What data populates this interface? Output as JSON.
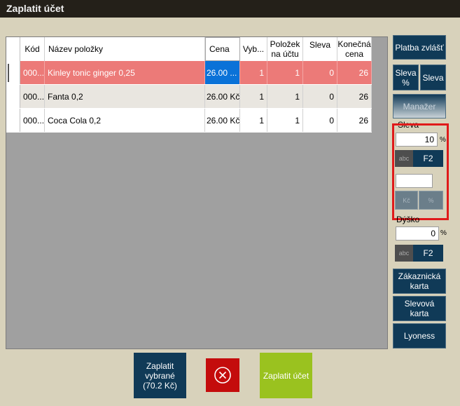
{
  "window": {
    "title": "Zaplatit účet"
  },
  "table": {
    "headers": {
      "kod": "Kód",
      "nazev": "Název položky",
      "cena": "Cena",
      "vyb": "Vyb...",
      "polozek_1": "Položek",
      "polozek_2": "na účtu",
      "sleva": "Sleva",
      "konecna_1": "Konečná",
      "konecna_2": "cena"
    },
    "rows": [
      {
        "kod": "000...",
        "nazev": "Kinley tonic ginger 0,25",
        "cena": "26.00 ...",
        "vyb": "1",
        "polozek": "1",
        "sleva": "0",
        "konecna": "26"
      },
      {
        "kod": "000...",
        "nazev": "Fanta 0,2",
        "cena": "26.00 Kč",
        "vyb": "1",
        "polozek": "1",
        "sleva": "0",
        "konecna": "26"
      },
      {
        "kod": "000...",
        "nazev": "Coca Cola 0,2",
        "cena": "26.00 Kč",
        "vyb": "1",
        "polozek": "1",
        "sleva": "0",
        "konecna": "26"
      }
    ]
  },
  "side": {
    "platba_zvlast": "Platba zvlášť",
    "sleva_pct_1": "Sleva",
    "sleva_pct_2": "%",
    "sleva_btn": "Sleva",
    "manager": "Manažer",
    "sleva_label": "Sleva",
    "sleva_value": "10",
    "percent": "%",
    "abc": "abc",
    "f2": "F2",
    "kc": "Kč",
    "pct_small": "%",
    "dysko_label": "Dýško",
    "dysko_value": "0",
    "zakaznicka_1": "Zákaznická",
    "zakaznicka_2": "karta",
    "slevova_1": "Slevová",
    "slevova_2": "karta",
    "lyoness": "Lyoness"
  },
  "bottom": {
    "zaplatit_vybrane_1": "Zaplatit",
    "zaplatit_vybrane_2": "vybrané",
    "zaplatit_vybrane_3": "(70.2 Kč)",
    "cancel_icon": "close-circle-icon",
    "zaplatit_ucet": "Zaplatit účet"
  },
  "colors": {
    "selected_row": "#ec7a78",
    "button_dark_blue": "#103a57",
    "cancel_red": "#c40c0c",
    "pay_green": "#9ac21f"
  }
}
